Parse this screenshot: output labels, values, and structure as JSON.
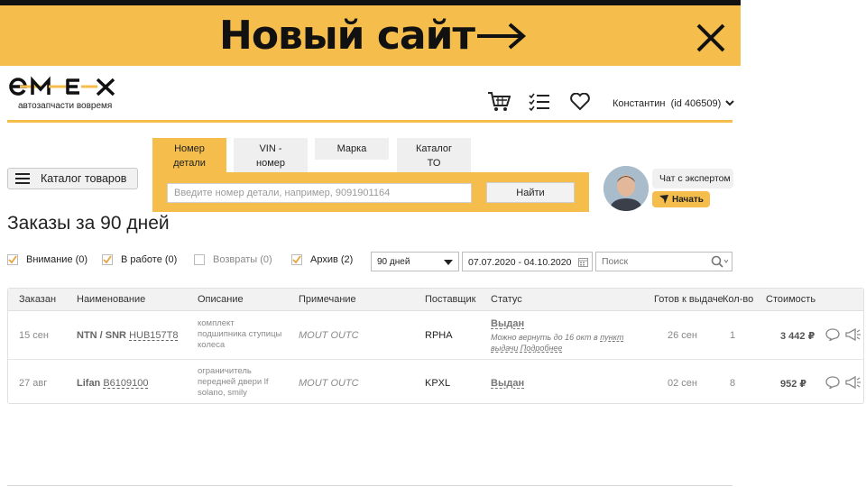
{
  "promo": {
    "text": "Новый сайт"
  },
  "logo": {
    "subtitle": "автозапчасти вовремя"
  },
  "user": {
    "name": "Константин",
    "id_label": "(id 406509)"
  },
  "catalog_button": {
    "label": "Каталог товаров"
  },
  "search_tabs": [
    {
      "label_line1": "Номер",
      "label_line2": "детали"
    },
    {
      "label_line1": "VIN -",
      "label_line2": "номер"
    },
    {
      "label_line1": "Марка",
      "label_line2": ""
    },
    {
      "label_line1": "Каталог",
      "label_line2": "ТО"
    }
  ],
  "search": {
    "placeholder": "Введите номер детали, например, 9091901164",
    "button": "Найти"
  },
  "expert": {
    "label": "Чат с экспертом",
    "start": "Начать"
  },
  "page_title": "Заказы за 90 дней",
  "filters": [
    {
      "label": "Внимание (0)",
      "checked": true
    },
    {
      "label": "В работе (0)",
      "checked": true
    },
    {
      "label": "Возвраты (0)",
      "checked": false
    },
    {
      "label": "Архив (2)",
      "checked": true
    }
  ],
  "period": {
    "selected": "90 дней"
  },
  "date_range": "07.07.2020 - 04.10.2020",
  "filter_search": {
    "placeholder": "Поиск"
  },
  "table": {
    "headers": [
      "Заказан",
      "Наименование",
      "Описание",
      "Примечание",
      "Поставщик",
      "Статус",
      "Готов к выдаче",
      "Кол-во",
      "Стоимость"
    ],
    "rows": [
      {
        "date": "15 сен",
        "brand": "NTN / SNR",
        "part": "HUB157T8",
        "desc1": "комплект",
        "desc2": "подшипника ступицы",
        "desc3": "колеса",
        "note": "MOUT OUTC",
        "supplier": "RPHA",
        "status": "Выдан",
        "status_note1": "Можно вернуть до 16 окт в",
        "status_note_link1": "пункт",
        "status_note_link2": "выдачи",
        "status_note_link3": "Подробнее",
        "ready": "26 сен",
        "qty": "1",
        "price": "3 442 ₽"
      },
      {
        "date": "27 авг",
        "brand": "Lifan",
        "part": "B6109100",
        "desc1": "ограничитель",
        "desc2": "передней двери lf",
        "desc3": "solano, smily",
        "note": "MOUT OUTC",
        "supplier": "KPXL",
        "status": "Выдан",
        "ready": "02 сен",
        "qty": "8",
        "price": "952 ₽"
      }
    ]
  },
  "colors": {
    "accent": "#f4bd4c",
    "dark": "#111111"
  }
}
